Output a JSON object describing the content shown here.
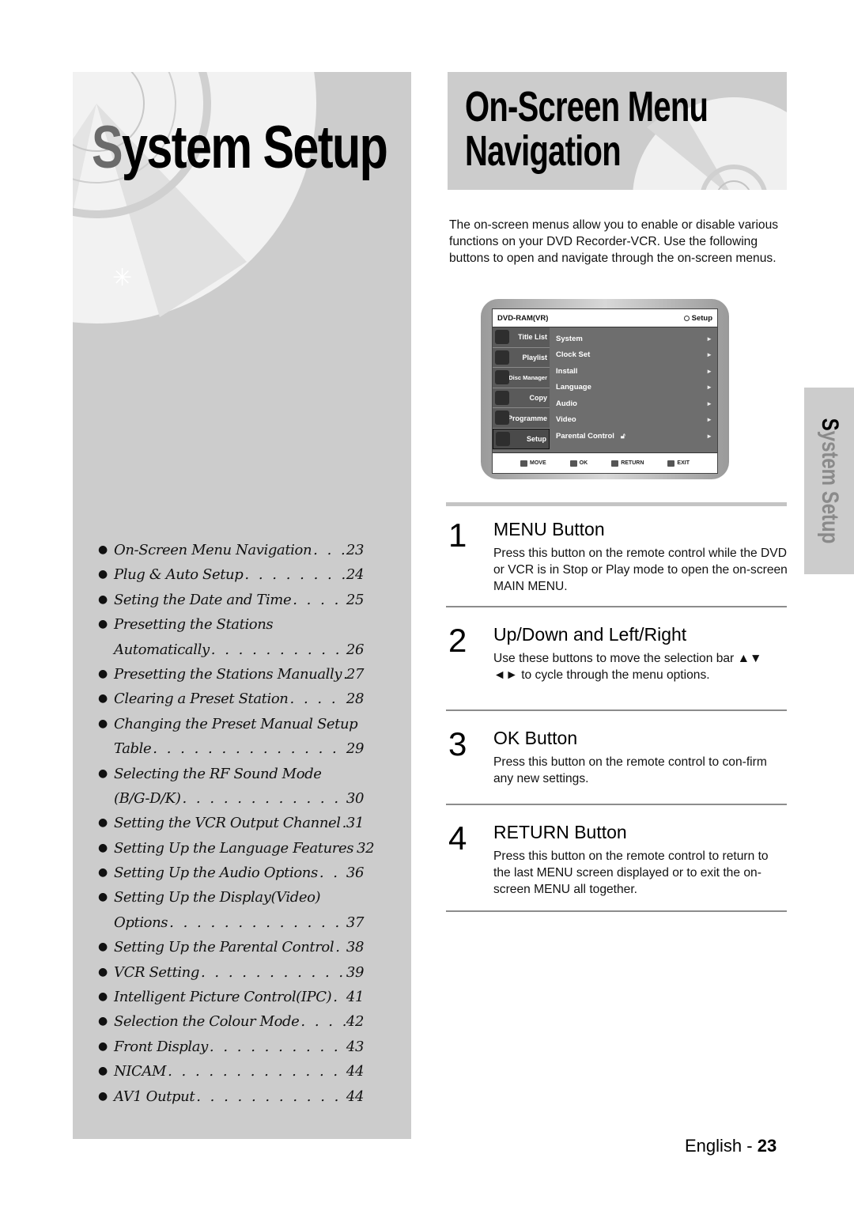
{
  "left_panel": {
    "title_first_letter": "S",
    "title_rest": "ystem Setup",
    "toc": [
      {
        "text": "On-Screen Menu Navigation",
        "page": "23",
        "bullet": true
      },
      {
        "text": "Plug & Auto Setup",
        "page": "24",
        "bullet": true
      },
      {
        "text": "Seting the Date and Time",
        "page": "25",
        "bullet": true
      },
      {
        "text": "Presetting the Stations",
        "page": "",
        "bullet": true
      },
      {
        "text": "Automatically",
        "page": "26",
        "bullet": false
      },
      {
        "text": "Presetting the Stations Manually",
        "page": "27",
        "bullet": true
      },
      {
        "text": "Clearing a Preset Station",
        "page": "28",
        "bullet": true
      },
      {
        "text": "Changing the Preset Manual Setup",
        "page": "",
        "bullet": true
      },
      {
        "text": "Table",
        "page": "29",
        "bullet": false
      },
      {
        "text": "Selecting the RF Sound Mode",
        "page": "",
        "bullet": true
      },
      {
        "text": "(B/G-D/K)",
        "page": "30",
        "bullet": false
      },
      {
        "text": "Setting the VCR Output Channel",
        "page": "31",
        "bullet": true
      },
      {
        "text": "Setting Up the Language Features",
        "page": "32",
        "bullet": true
      },
      {
        "text": "Setting Up the Audio Options",
        "page": "36",
        "bullet": true
      },
      {
        "text": "Setting Up the Display(Video)",
        "page": "",
        "bullet": true
      },
      {
        "text": "Options",
        "page": "37",
        "bullet": false
      },
      {
        "text": "Setting Up the Parental Control",
        "page": "38",
        "bullet": true
      },
      {
        "text": "VCR Setting",
        "page": "39",
        "bullet": true
      },
      {
        "text": "Intelligent Picture Control(IPC)",
        "page": "41",
        "bullet": true
      },
      {
        "text": "Selection the Colour Mode",
        "page": "42",
        "bullet": true
      },
      {
        "text": "Front Display",
        "page": "43",
        "bullet": true
      },
      {
        "text": "NICAM",
        "page": "44",
        "bullet": true
      },
      {
        "text": "AV1 Output",
        "page": "44",
        "bullet": true
      }
    ]
  },
  "header": {
    "title_line1": "On-Screen Menu",
    "title_line2": "Navigation"
  },
  "intro": "The on-screen menus allow you to enable or disable various functions on your DVD Recorder-VCR. Use the following buttons to open and navigate through the on-screen menus.",
  "osd": {
    "disc_type": "DVD-RAM(VR)",
    "current_section": "Setup",
    "side_tabs": [
      {
        "label": "Title List",
        "icon": "title-list-icon"
      },
      {
        "label": "Playlist",
        "icon": "playlist-icon"
      },
      {
        "label": "Disc Manager",
        "icon": "disc-manager-icon"
      },
      {
        "label": "Copy",
        "icon": "copy-icon"
      },
      {
        "label": "Programme",
        "icon": "programme-icon"
      },
      {
        "label": "Setup",
        "icon": "gear-icon",
        "active": true
      }
    ],
    "items": [
      {
        "label": "System"
      },
      {
        "label": "Clock Set"
      },
      {
        "label": "Install"
      },
      {
        "label": "Language"
      },
      {
        "label": "Audio"
      },
      {
        "label": "Video"
      },
      {
        "label": "Parental Control"
      }
    ],
    "arrow": "►",
    "bottom_keys": [
      {
        "label": "MOVE",
        "icon": "updown-icon"
      },
      {
        "label": "OK",
        "icon": "ok-icon"
      },
      {
        "label": "RETURN",
        "icon": "return-icon"
      },
      {
        "label": "EXIT",
        "icon": "exit-icon"
      }
    ]
  },
  "steps": [
    {
      "num": "1",
      "title": "MENU Button",
      "desc": "Press this button on the remote control while the DVD or VCR is in Stop or Play mode to open the on-screen MAIN MENU."
    },
    {
      "num": "2",
      "title": "Up/Down and Left/Right",
      "desc": "Use these buttons to move the selection bar ▲▼ ◄► to cycle through the menu options."
    },
    {
      "num": "3",
      "title": "OK Button",
      "desc": "Press this button on the remote control to con-firm any new settings."
    },
    {
      "num": "4",
      "title": "RETURN Button",
      "desc": "Press this button on the remote control to return to the last MENU screen displayed or to exit the on-screen MENU all together."
    }
  ],
  "side_tab": {
    "first_letter": "S",
    "rest": "ystem Setup"
  },
  "footer": {
    "language": "English - ",
    "page": "23"
  }
}
